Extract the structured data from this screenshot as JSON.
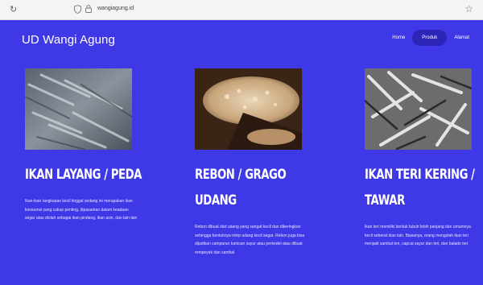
{
  "browser": {
    "reload_icon": "reload-icon",
    "url": "wangiagung.id",
    "bookmark_icon": "star-icon"
  },
  "header": {
    "site_title": "UD Wangi Agung"
  },
  "nav": {
    "items": [
      {
        "label": "Home",
        "active": false
      },
      {
        "label": "Produk",
        "active": true
      },
      {
        "label": "Alamat",
        "active": false
      }
    ]
  },
  "products": [
    {
      "image": "dried-scad-fish-image",
      "name": "IKAN LAYANG / PEDA",
      "description": "Ikan-ikan tangkapan kecil tinggal sedang ini merupakan ikan konsumsi yang cukup penting, dipasarkan dalam keadaan segar atau diolah sebagai ikan pindang, ikan asin, dan lain-lain"
    },
    {
      "image": "rebon-shrimp-image",
      "name": "REBON / GRAGO UDANG",
      "description": "Rebon dibuat dari udang yang sangat kecil dan dikeringkan sehingga bentuknya mirip udang kecil segar. Rebon juga bisa dijadikan campuran tumisan sayur atau perkedel atau dibuat rempeyek dan sambal"
    },
    {
      "image": "dried-anchovy-image",
      "name": "IKAN TERI KERING / TAWAR",
      "description": "Ikan teri memiliki bentuk tubuh lebih panjang dan umumnya kecil seberat ikan lain. Biasanya, orang mengolah ikan teri menjadi sambal teri, capcai sayur dan teri, dan balado teri"
    }
  ],
  "colors": {
    "background": "#3f38e6",
    "nav_active": "#2d25b8",
    "text": "#ffffff"
  }
}
